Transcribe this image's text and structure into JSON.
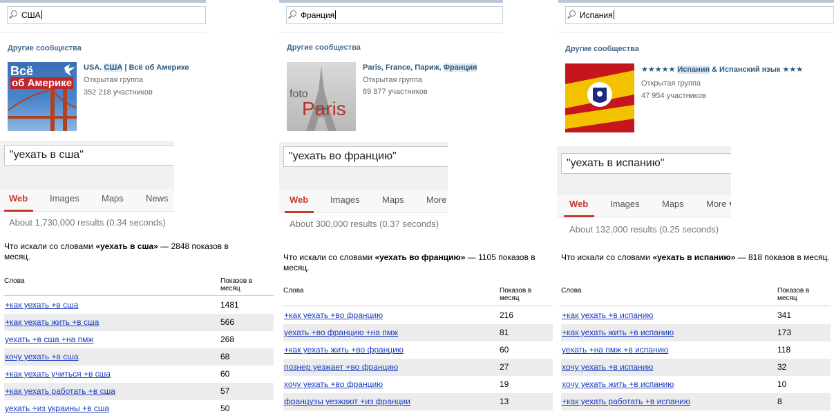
{
  "panels": [
    {
      "community_search": {
        "query": "США",
        "heading": "Другие сообщества",
        "title_parts": [
          "USA. ",
          "США",
          " | Всё об Америке"
        ],
        "type": "Открытая группа",
        "members": "352 218 участников",
        "thumb_text": [
          "Всё",
          "об Америке"
        ]
      },
      "google": {
        "query": "\"уехать в сша\"",
        "tabs": [
          "Web",
          "Images",
          "Maps",
          "News"
        ],
        "stats": "About 1,730,000 results (0.34 seconds)"
      },
      "wordstat": {
        "desc_prefix": "Что искали со словами ",
        "desc_bold": "«уехать в сша»",
        "desc_suffix": " — 2848 показов в месяц.",
        "col_words": "Слова",
        "col_count": "Показов в месяц",
        "rows": [
          {
            "q": "+как уехать +в сша",
            "n": "1481"
          },
          {
            "q": "+как уехать жить +в сша",
            "n": "566"
          },
          {
            "q": "уехать +в сша +на пмж",
            "n": "268"
          },
          {
            "q": "хочу уехать +в сша",
            "n": "68"
          },
          {
            "q": "+как уехать учиться +в сша",
            "n": "60"
          },
          {
            "q": "+как уехать работать +в сша",
            "n": "57"
          },
          {
            "q": "уехать +из украины +в сша",
            "n": "50"
          }
        ]
      }
    },
    {
      "community_search": {
        "query": "Франция",
        "heading": "Другие сообщества",
        "title_parts": [
          "Paris, France, Париж, ",
          "Франция",
          ""
        ],
        "type": "Открытая группа",
        "members": "89 877 участников",
        "thumb_text": [
          "foto",
          "Paris"
        ]
      },
      "google": {
        "query": "\"уехать во францию\"",
        "tabs": [
          "Web",
          "Images",
          "Maps",
          "More"
        ],
        "stats": "About 300,000 results (0.37 seconds)"
      },
      "wordstat": {
        "desc_prefix": "Что искали со словами ",
        "desc_bold": "«уехать во францию»",
        "desc_suffix": " — 1105 показов в месяц.",
        "col_words": "Слова",
        "col_count": "Показов в месяц",
        "rows": [
          {
            "q": "+как уехать +во францию",
            "n": "216"
          },
          {
            "q": "уехать +во францию +на пмж",
            "n": "81"
          },
          {
            "q": "+как уехать жить +во францию",
            "n": "60"
          },
          {
            "q": "познер уезжает +во францию",
            "n": "27"
          },
          {
            "q": "хочу уехать +во францию",
            "n": "19"
          },
          {
            "q": "французы уезжают +из франции",
            "n": "13"
          }
        ]
      }
    },
    {
      "community_search": {
        "query": "Испания",
        "heading": "Другие сообщества",
        "title_parts": [
          "★★★★★ ",
          "Испания",
          " & Испанский язык ★★★"
        ],
        "type": "Открытая группа",
        "members": "47 954 участников",
        "thumb_text": [
          "",
          ""
        ]
      },
      "google": {
        "query": "\"уехать в испанию\"",
        "tabs": [
          "Web",
          "Images",
          "Maps",
          "More ▾"
        ],
        "stats": "About 132,000 results (0.25 seconds)"
      },
      "wordstat": {
        "desc_prefix": "Что искали со словами ",
        "desc_bold": "«уехать в испанию»",
        "desc_suffix": " — 818 показов в месяц.",
        "col_words": "Слова",
        "col_count": "Показов в месяц",
        "rows": [
          {
            "q": "+как уехать +в испанию",
            "n": "341"
          },
          {
            "q": "+как уехать жить +в испанию",
            "n": "173"
          },
          {
            "q": "уехать +на пмж +в испанию",
            "n": "118"
          },
          {
            "q": "хочу уехать +в испанию",
            "n": "32"
          },
          {
            "q": "хочу уехать жить +в испанию",
            "n": "10"
          },
          {
            "q": "+как уехать работать +в испанию",
            "n": "8"
          }
        ]
      }
    }
  ],
  "colors": {
    "vk_link": "#2b587a",
    "vk_heading": "#45688e",
    "google_active": "#c53929",
    "wordstat_link": "#1a3dc1",
    "wordstat_alt_row": "#ececec"
  }
}
